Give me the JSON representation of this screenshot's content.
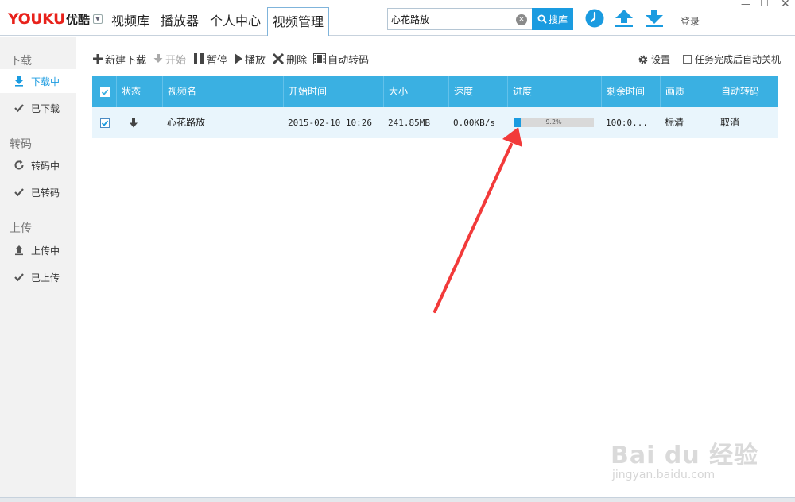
{
  "app": {
    "logo_en": "YOUKU",
    "logo_cn": "优酷"
  },
  "nav": {
    "tabs": [
      {
        "label": "视频库"
      },
      {
        "label": "播放器"
      },
      {
        "label": "个人中心"
      },
      {
        "label": "视频管理",
        "active": true
      }
    ]
  },
  "search": {
    "value": "心花路放",
    "button_label": "搜库"
  },
  "header": {
    "login_label": "登录",
    "icons": [
      "clock-icon",
      "upload-icon",
      "download-icon"
    ]
  },
  "sidebar": {
    "sections": [
      {
        "title": "下载",
        "items": [
          {
            "label": "下载中",
            "icon": "download-icon",
            "active": true
          },
          {
            "label": "已下载",
            "icon": "check-icon"
          }
        ]
      },
      {
        "title": "转码",
        "items": [
          {
            "label": "转码中",
            "icon": "refresh-icon"
          },
          {
            "label": "已转码",
            "icon": "check-icon"
          }
        ]
      },
      {
        "title": "上传",
        "items": [
          {
            "label": "上传中",
            "icon": "upload-icon"
          },
          {
            "label": "已上传",
            "icon": "check-icon"
          }
        ]
      }
    ]
  },
  "toolbar": {
    "new_download": "新建下载",
    "start": "开始",
    "pause": "暂停",
    "play": "播放",
    "delete": "删除",
    "auto_transcode": "自动转码",
    "settings": "设置",
    "auto_shutdown": "任务完成后自动关机"
  },
  "table": {
    "columns": [
      "状态",
      "视频名",
      "开始时间",
      "大小",
      "速度",
      "进度",
      "剩余时间",
      "画质",
      "自动转码"
    ],
    "rows": [
      {
        "checked": true,
        "status": "downloading",
        "name": "心花路放",
        "start_time": "2015-02-10 10:26",
        "size": "241.85MB",
        "speed": "0.00KB/s",
        "progress_text": "9.2%",
        "progress_value": 0.092,
        "remaining": "100:0...",
        "quality": "标清",
        "auto_transcode": "取消"
      }
    ]
  },
  "watermark": {
    "logo": "Bai du 经验",
    "url": "jingyan.baidu.com"
  },
  "colors": {
    "accent": "#1a9be0",
    "header_bg": "#3ab0e2",
    "row_bg": "#e9f5fc",
    "annotation_arrow": "#f23a3a"
  }
}
